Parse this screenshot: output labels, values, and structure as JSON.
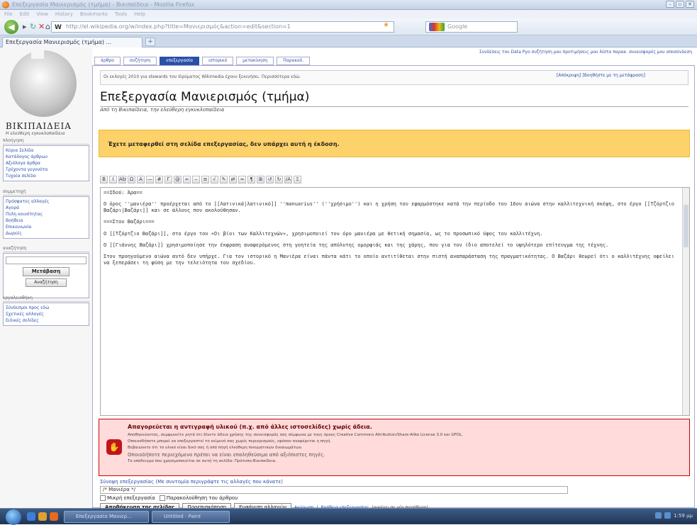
{
  "browser": {
    "window_title": "Επεξεργασία Μανιερισμός (τμήμα) - Βικιπαίδεια - Mozilla Firefox",
    "menu": [
      "File",
      "Edit",
      "View",
      "History",
      "Bookmarks",
      "Tools",
      "Help"
    ],
    "url": "http://el.wikipedia.org/w/index.php?title=Μανιερισμός&action=edit&section=1",
    "search_placeholder": "Google",
    "tab_title": "Επεξεργασία Μανιερισμός (τμήμα) ...",
    "new_tab": "+"
  },
  "sidebar": {
    "wiki_name": "ΒΙΚΙΠΑΙΔΕΙΑ",
    "wiki_sub": "Η ελεύθερη εγκυκλοπαίδεια",
    "nav_heading": "πλοήγηση",
    "nav_items": [
      "Κύρια Σελίδα",
      "Κατάλογος άρθρων",
      "Αξιόλογα άρθρα",
      "Τρέχοντα γεγονότα",
      "Τυχαία σελίδα"
    ],
    "inter_heading": "συμμετοχή",
    "inter_items": [
      "Πρόσφατες αλλαγές",
      "Αγορά",
      "Πύλη κοινότητας",
      "Βοήθεια",
      "Επικοινωνία",
      "Δωρεές"
    ],
    "search_heading": "αναζήτηση",
    "search_button": "Μετάβαση",
    "search_button2": "Αναζήτηση",
    "tools_heading": "εργαλειοθήκη",
    "tools_items": [
      "Σύνδεσμοι προς εδώ",
      "Σχετικές αλλαγές",
      "Ειδικές σελίδες"
    ]
  },
  "personal": "Συνδέσεις του Data   Pyo   συζήτηση μου   προτιμήσεις μου   λίστα παρακ.   συνεισφορές μου   αποσύνδεση",
  "content_tabs": [
    "άρθρο",
    "συζήτηση",
    "επεξεργασία",
    "ιστορικό",
    "μετακίνηση",
    "Παρακολ."
  ],
  "sitenotice": {
    "text": "Οι εκλογές 2010 για stewards του Ιδρύματος Wikimedia έχουν ξεκινήσει. Περισσότερα εδώ.",
    "right": "[Απόκρυψη] [Βοηθήστε με τη μετάφραση]"
  },
  "page_title": "Επεξεργασία Μανιερισμός (τμήμα)",
  "page_subtitle": "Από τη Βικιπαίδεια, την ελεύθερη εγκυκλοπαίδεια",
  "warning_box": "Έχετε μεταφερθεί στη σελίδα επεξεργασίας, δεν υπάρχει αυτή η έκδοση.",
  "toolbar_icons": [
    "B",
    "I",
    "Ab",
    "Ω",
    "A",
    "—",
    "#",
    "Γ",
    "@",
    "∞",
    "⎯",
    "≡",
    "√",
    "✎",
    "⇄",
    "≈",
    "¶",
    "⊞",
    "↺",
    "↻",
    "/A",
    "Ξ"
  ],
  "edit_text": [
    "==Ιδού: Άρα==",
    "Ο όρος ''μανιέρα'' προέρχεται από το [[Λατινικά|λατινικό]] ''manuarius'' (''χρήσιμο'') και η χρήση του εφαρμόστηκε κατά την περίοδο του 16ου αιώνα στην καλλιτεχνική σκέψη, στο έργο [[Τζόρτζιο Βαζάρι|Βαζάρι]] και σε άλλους που ακολούθησαν.",
    "===Στον Βαζάρι===",
    "Ο [[Τζόρτζιο Βαζάρι]], στο έργο του «Οι βίοι των Καλλιτεχνών», χρησιμοποιεί τον όρο μανιέρα με θετική σημασία, ως το προσωπικό ύφος του καλλιτέχνη.",
    "Ο [[Γιάννης Βαζάρι]] χρησιμοποίησε την έκφραση αναφερόμενος στη γοητεία της απόλυτης ομορφιάς και της χάρης, που για τον ίδιο αποτελεί το υψηλότερο επίτευγμα της τέχνης.",
    "Στον προηγούμενο αιώνα αυτό δεν υπήρχε. Για τον ιστορικό η Μανιέρα είναι πάντα κάτι το οποίο αντιτίθεται στην πιστή αναπαράσταση της πραγματικότητας. Ο Βαζάρι θεωρεί ότι ο καλλιτέχνης οφείλει να ξεπεράσει τη φύση με την τελειότητα του σχεδίου."
  ],
  "copy_warning": {
    "heading": "Απαγορεύεται η αντιγραφή υλικού (π.χ. από άλλες ιστοσελίδες) χωρίς άδεια.",
    "line1": "Αποθηκεύοντας, συμφωνείτε ρητά ότι δίνετε άδεια χρήσης της συνεισφοράς σας σύμφωνα με τους όρους Creative Commons Attribution/Share-Alike License 3.0 και GFDL.",
    "line2": "Οποιοσδήποτε μπορεί να επεξεργαστεί το κείμενό σας χωρίς περιορισμούς, εφόσον αναφέρεται η πηγή.",
    "line3": "Βεβαιώνετε ότι το υλικό είναι δικό σας ή από πηγή ελεύθερη πνευματικών δικαιωμάτων.",
    "line4": "Οποιοδήποτε περιεχόμενο πρέπει να είναι επαληθεύσιμο από αξιόπιστες πηγές.",
    "line5": "Το υπόδειγμα που χρησιμοποιείται σε αυτή τη σελίδα: Πρότυπο:Βικιπαίδεια."
  },
  "summary_label": "Σύνοψη επεξεργασίας (Με συντομία περιγράψτε τις αλλαγές που κάνατε)",
  "summary_value": "/* Μανιέρα */",
  "minor_label": "Μικρή επεξεργασία",
  "watch_label": "Παρακολούθηση του άρθρου",
  "buttons": {
    "save": "Αποθήκευση της σελίδας",
    "preview": "Προεπισκόπηση",
    "diff": "Εμφάνιση αλλαγών",
    "cancel": "Ακύρωση",
    "help": "Βοήθεια επεξεργασίας",
    "help_note": "(ανοίγει σε νέο παράθυρο)"
  },
  "taskbar": {
    "task1": "Επεξεργασία Μανιερ...",
    "task2": "Untitled - Paint",
    "clock": "1:59 μμ"
  }
}
